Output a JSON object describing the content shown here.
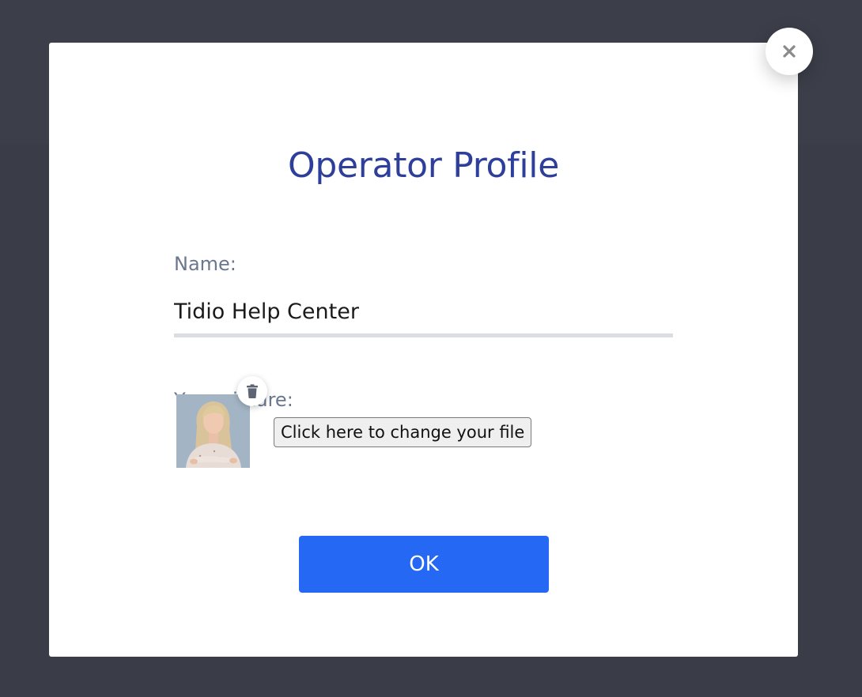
{
  "modal": {
    "title": "Operator Profile",
    "name_label": "Name:",
    "name_value": "Tidio Help Center",
    "picture_label": "Your picture:",
    "change_file_label": "Click here to change your file",
    "ok_label": "OK"
  },
  "icons": {
    "close": "close-icon",
    "delete": "trash-icon",
    "avatar": "avatar-photo"
  },
  "colors": {
    "backdrop": "#3a3d47",
    "title": "#2e3f9b",
    "label": "#6b778e",
    "primary_button": "#2468f4",
    "close_icon": "#8a8a8a"
  }
}
